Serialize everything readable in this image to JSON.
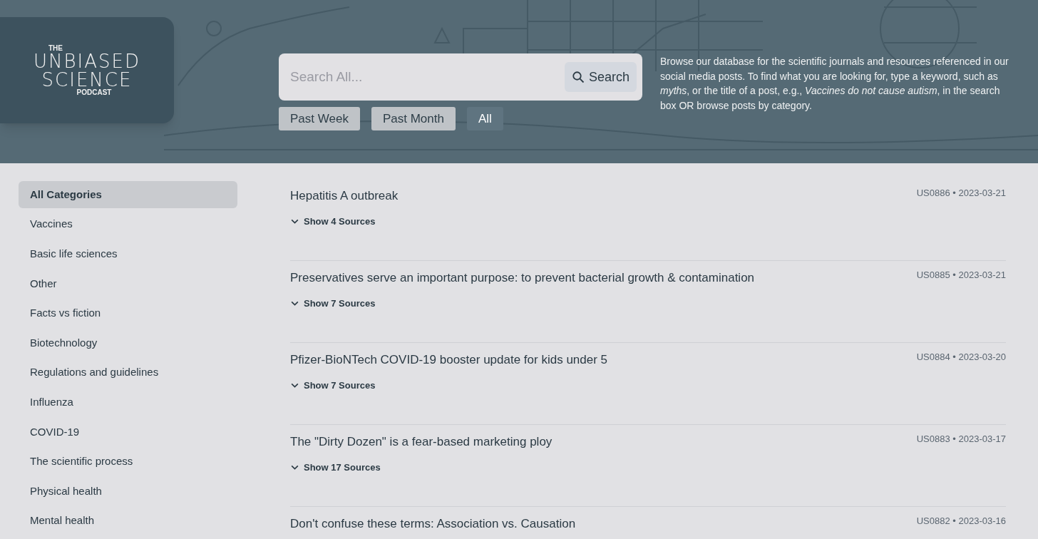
{
  "logo": {
    "line_1": "THE",
    "line_2": "UNBIASED",
    "line_3": "SCIENCE",
    "line_4": "PODCAST"
  },
  "search": {
    "placeholder": "Search All...",
    "button": "Search"
  },
  "filters": [
    {
      "label": "Past Week",
      "selected": false
    },
    {
      "label": "Past Month",
      "selected": false
    },
    {
      "label": "All",
      "selected": true
    }
  ],
  "description": "Browse our database for the scientific journals and resources referenced in our social media posts. To find what you are looking for, type a keyword, such as *myths*, or the title of a post, e.g., *Vaccines do not cause autism*, in the search box OR browse posts by category.",
  "sidebar": {
    "items": [
      {
        "label": "All Categories",
        "selected": true
      },
      {
        "label": "Vaccines",
        "selected": false
      },
      {
        "label": "Basic life sciences",
        "selected": false
      },
      {
        "label": "Other",
        "selected": false
      },
      {
        "label": "Facts vs fiction",
        "selected": false
      },
      {
        "label": "Biotechnology",
        "selected": false
      },
      {
        "label": "Regulations and guidelines",
        "selected": false
      },
      {
        "label": "Influenza",
        "selected": false
      },
      {
        "label": "COVID-19",
        "selected": false
      },
      {
        "label": "The scientific process",
        "selected": false
      },
      {
        "label": "Physical health",
        "selected": false
      },
      {
        "label": "Mental health",
        "selected": false
      }
    ]
  },
  "posts": [
    {
      "title": "Hepatitis A outbreak",
      "meta": "US0886 • 2023-03-21",
      "sources": "Show 4 Sources",
      "expanded": false
    },
    {
      "title": "Preservatives serve an important purpose: to prevent bacterial growth & contamination",
      "meta": "US0885 • 2023-03-21",
      "sources": "Show 7 Sources",
      "expanded": false
    },
    {
      "title": "Pfizer-BioNTech COVID-19 booster update for kids under 5",
      "meta": "US0884 • 2023-03-20",
      "sources": "Show 7 Sources",
      "expanded": false
    },
    {
      "title": "The \"Dirty Dozen\" is a fear-based marketing ploy",
      "meta": "US0883 • 2023-03-17",
      "sources": "Show 17 Sources",
      "expanded": false
    },
    {
      "title": "Don't confuse these terms: Association vs. Causation",
      "meta": "US0882 • 2023-03-16"
    }
  ]
}
